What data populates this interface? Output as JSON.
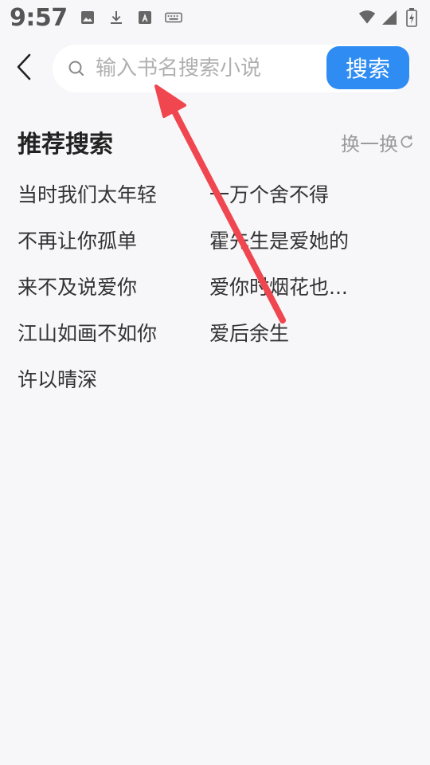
{
  "status_bar": {
    "time": "9:57",
    "icons": [
      "image-icon",
      "download-icon",
      "font-icon",
      "keyboard-icon"
    ],
    "right_icons": [
      "wifi-icon",
      "signal-icon",
      "battery-icon"
    ]
  },
  "header": {
    "back_icon": "chevron-left-icon",
    "search": {
      "placeholder": "输入书名搜索小说",
      "value": ""
    },
    "search_button_label": "搜索"
  },
  "recommend": {
    "title": "推荐搜索",
    "refresh_label": "换一换",
    "items": [
      "当时我们太年轻",
      "一万个舍不得",
      "不再让你孤单",
      "霍先生是爱她的",
      "来不及说爱你",
      "爱你时烟花也...",
      "江山如画不如你",
      "爱后余生",
      "许以晴深"
    ]
  },
  "colors": {
    "background": "#f7f7f9",
    "accent": "#2f8cf3",
    "annotation_arrow": "#f0464f"
  }
}
